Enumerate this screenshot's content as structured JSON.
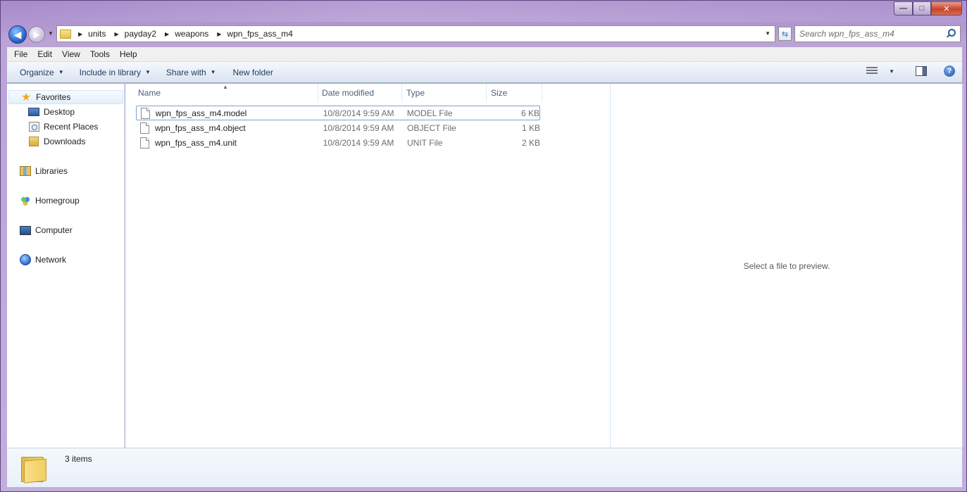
{
  "window": {
    "caption_buttons": {
      "minimize": "—",
      "maximize": "□",
      "close": "✕"
    }
  },
  "nav": {
    "back_glyph": "◀",
    "forward_glyph": "▶",
    "breadcrumb": [
      "units",
      "payday2",
      "weapons",
      "wpn_fps_ass_m4"
    ],
    "search_placeholder": "Search wpn_fps_ass_m4"
  },
  "menubar": [
    "File",
    "Edit",
    "View",
    "Tools",
    "Help"
  ],
  "commandbar": {
    "organize": "Organize",
    "include_in_library": "Include in library",
    "share_with": "Share with",
    "new_folder": "New folder",
    "help_glyph": "?"
  },
  "sidebar": {
    "favorites": "Favorites",
    "favorites_items": [
      "Desktop",
      "Recent Places",
      "Downloads"
    ],
    "libraries": "Libraries",
    "homegroup": "Homegroup",
    "computer": "Computer",
    "network": "Network"
  },
  "filelist": {
    "columns": [
      "Name",
      "Date modified",
      "Type",
      "Size"
    ],
    "rows": [
      {
        "name": "wpn_fps_ass_m4.model",
        "date": "10/8/2014 9:59 AM",
        "type": "MODEL File",
        "size": "6 KB"
      },
      {
        "name": "wpn_fps_ass_m4.object",
        "date": "10/8/2014 9:59 AM",
        "type": "OBJECT File",
        "size": "1 KB"
      },
      {
        "name": "wpn_fps_ass_m4.unit",
        "date": "10/8/2014 9:59 AM",
        "type": "UNIT File",
        "size": "2 KB"
      }
    ]
  },
  "preview": {
    "empty_text": "Select a file to preview."
  },
  "status": {
    "item_count": "3 items"
  }
}
